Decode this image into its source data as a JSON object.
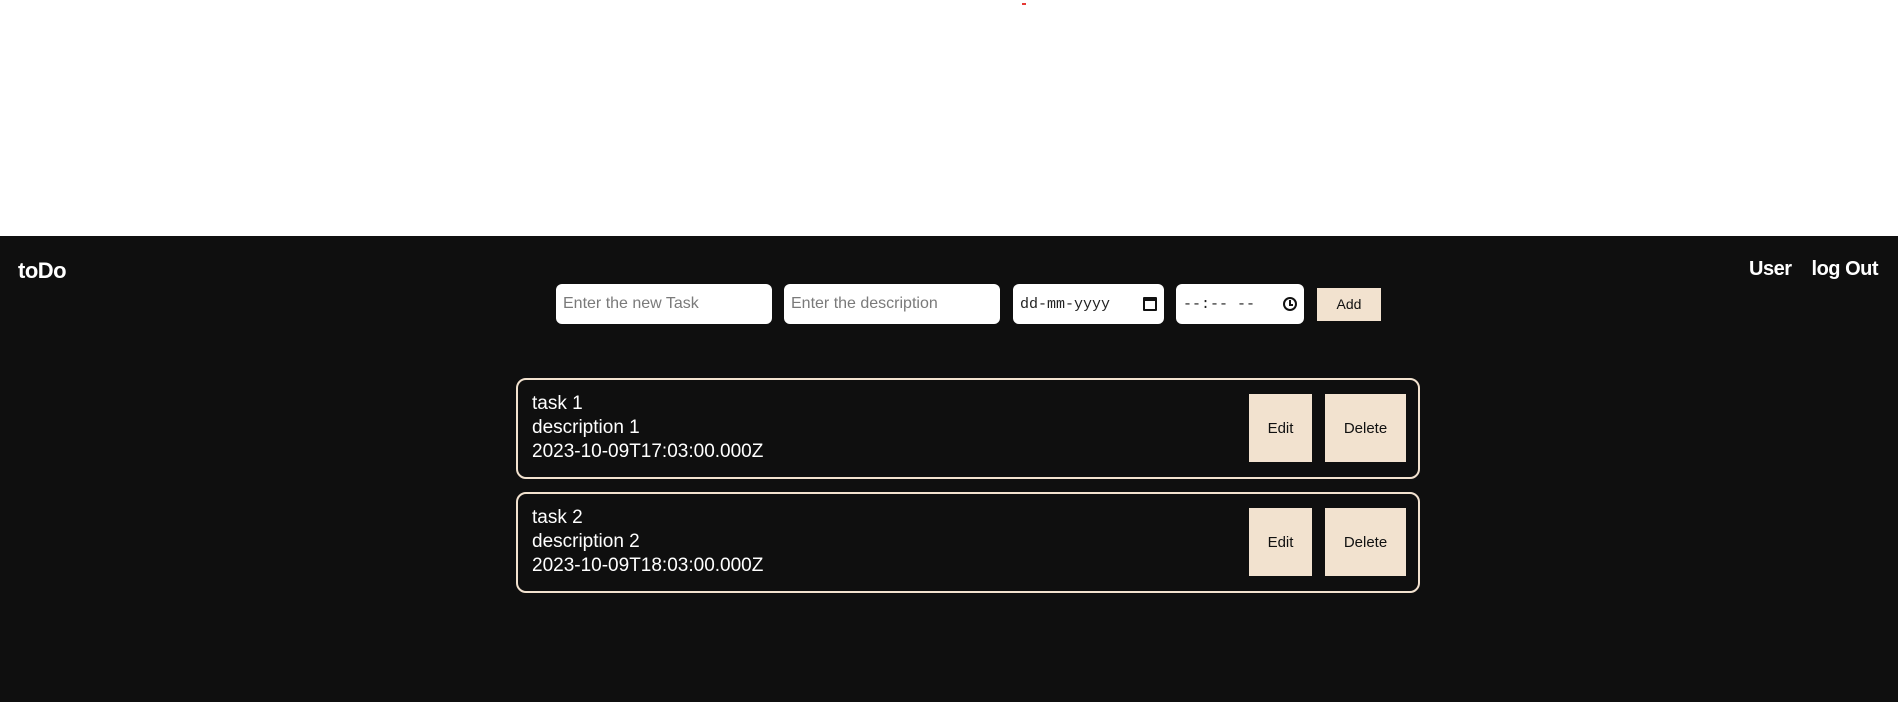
{
  "header": {
    "brand": "toDo",
    "nav": {
      "user": "User",
      "logout": "log Out"
    }
  },
  "form": {
    "task_placeholder": "Enter the new Task",
    "description_placeholder": "Enter the description",
    "date_placeholder": "dd-mm-yyyy",
    "time_placeholder": "--:-- --",
    "add_label": "Add"
  },
  "tasks": [
    {
      "title": "task 1",
      "description": "description 1",
      "datetime": "2023-10-09T17:03:00.000Z",
      "edit_label": "Edit",
      "delete_label": "Delete"
    },
    {
      "title": "task 2",
      "description": "description 2",
      "datetime": "2023-10-09T18:03:00.000Z",
      "edit_label": "Edit",
      "delete_label": "Delete"
    }
  ],
  "colors": {
    "background": "#0f0f0f",
    "accent": "#f2e2cf",
    "text": "#ffffff"
  }
}
